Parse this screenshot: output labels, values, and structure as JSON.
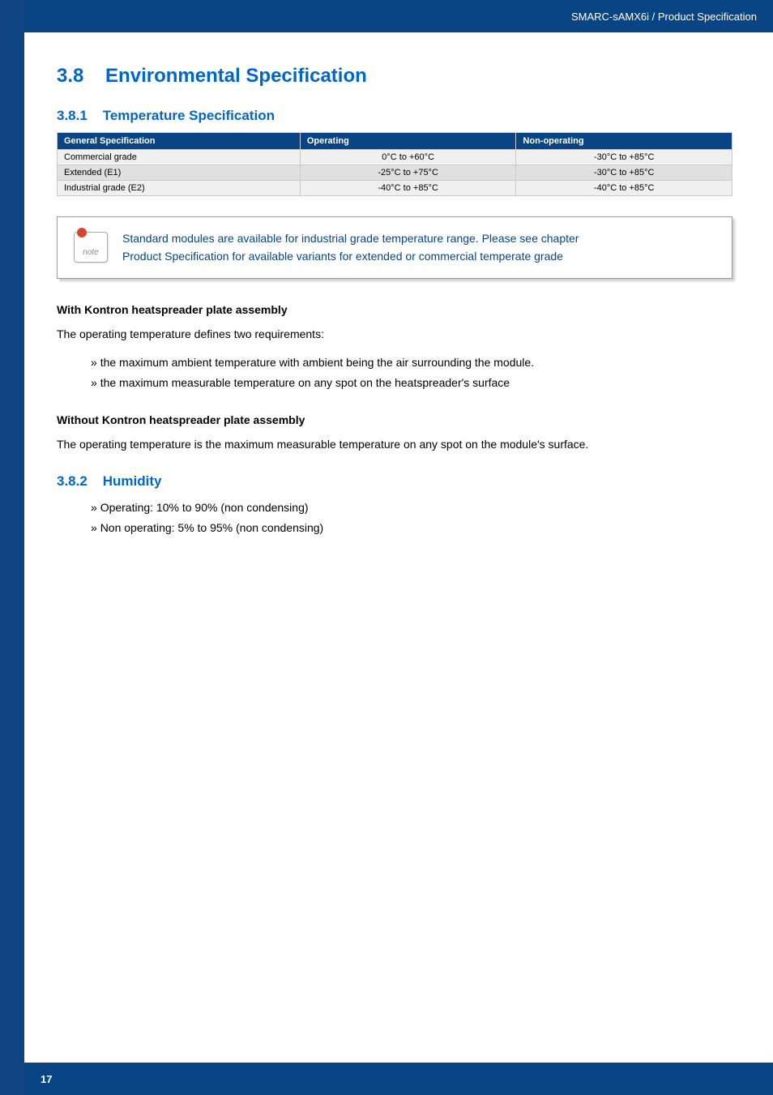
{
  "header": {
    "breadcrumb": "SMARC-sAMX6i / Product Specification"
  },
  "section": {
    "number": "3.8",
    "title": "Environmental Specification"
  },
  "subsection1": {
    "number": "3.8.1",
    "title": "Temperature Specification"
  },
  "table": {
    "headers": [
      "General Specification",
      "Operating",
      "Non-operating"
    ],
    "rows": [
      {
        "spec": "Commercial grade",
        "operating": "0°C to +60°C",
        "nonop": "-30°C to +85°C"
      },
      {
        "spec": "Extended (E1)",
        "operating": "-25°C to +75°C",
        "nonop": "-30°C to +85°C"
      },
      {
        "spec": "Industrial grade (E2)",
        "operating": "-40°C to +85°C",
        "nonop": "-40°C to +85°C"
      }
    ]
  },
  "note": {
    "line1": "Standard modules are available for industrial grade temperature range. Please see chapter",
    "line2": "Product Specification for available variants for extended or commercial temperate grade"
  },
  "withHeatspreader": {
    "heading": "With Kontron heatspreader plate assembly",
    "intro": "The operating temperature defines two requirements:",
    "bullets": [
      "the maximum ambient temperature with ambient being the air surrounding the module.",
      "the maximum measurable temperature on any spot on the heatspreader's surface"
    ]
  },
  "withoutHeatspreader": {
    "heading": "Without Kontron heatspreader plate assembly",
    "text": "The operating temperature is the maximum measurable temperature on any spot on the module's surface."
  },
  "subsection2": {
    "number": "3.8.2",
    "title": "Humidity",
    "bullets": [
      "Operating: 10% to 90% (non condensing)",
      "Non operating: 5% to 95% (non condensing)"
    ]
  },
  "footer": {
    "pageNumber": "17"
  }
}
